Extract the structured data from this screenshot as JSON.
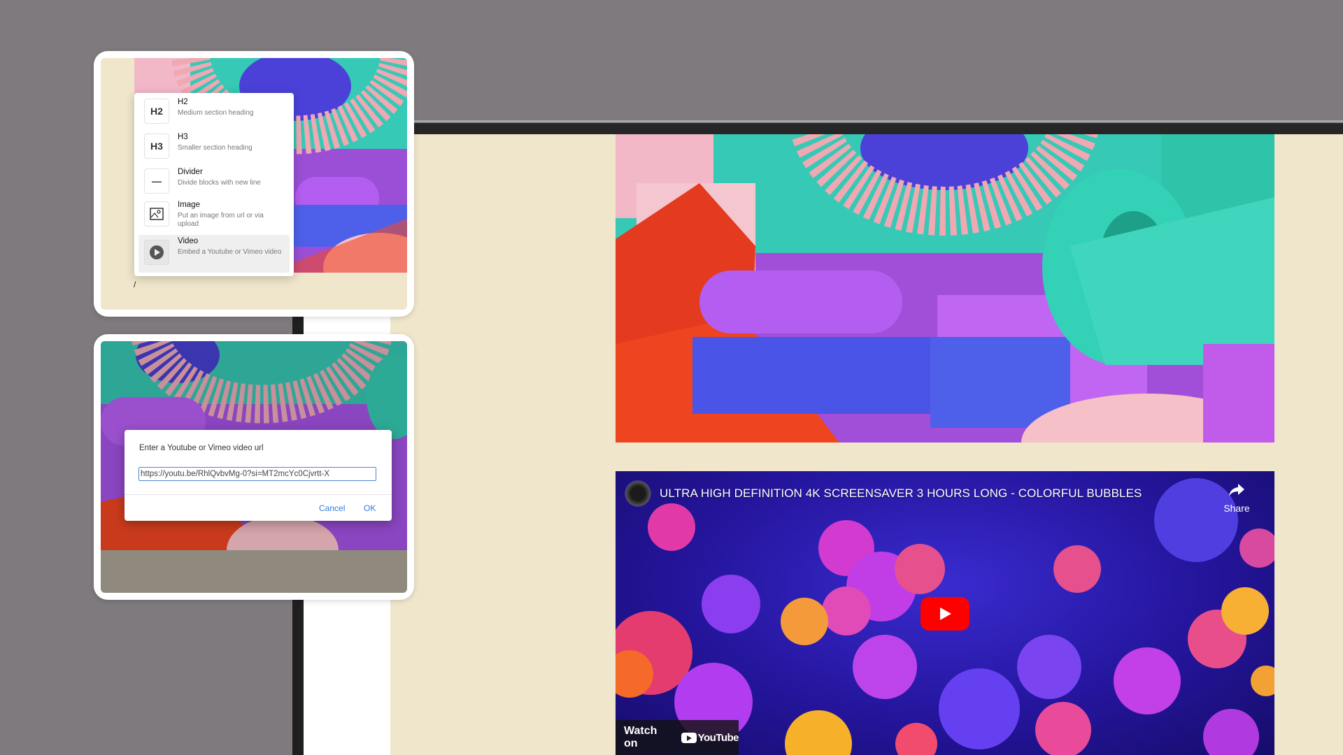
{
  "slash_menu": {
    "items": [
      {
        "icon": "H2",
        "icon_name": "heading-2-icon",
        "title": "H2",
        "desc": "Medium section heading"
      },
      {
        "icon": "H3",
        "icon_name": "heading-3-icon",
        "title": "H3",
        "desc": "Smaller section heading"
      },
      {
        "icon": "—",
        "icon_name": "divider-icon",
        "title": "Divider",
        "desc": "Divide blocks with new line"
      },
      {
        "icon": "",
        "icon_name": "image-icon",
        "title": "Image",
        "desc": "Put an image from url or via upload"
      },
      {
        "icon": "",
        "icon_name": "video-play-icon",
        "title": "Video",
        "desc": "Embed a Youtube or Vimeo video",
        "active": true
      }
    ],
    "slash_text": "/"
  },
  "video_dialog": {
    "label": "Enter a Youtube or Vimeo video url",
    "input_value": "https://youtu.be/RhlQvbvMg-0?si=MT2mcYc0Cjvrtt-X",
    "cancel_label": "Cancel",
    "ok_label": "OK"
  },
  "youtube_embed": {
    "title": "ULTRA HIGH DEFINITION 4K SCREENSAVER 3 HOURS LONG - COLORFUL BUBBLES",
    "share_label": "Share",
    "watch_on_label": "Watch on",
    "logo_text": "YouTube",
    "accent_color": "#ff0000"
  },
  "colors": {
    "canvas_bg": "#efe6cb",
    "outer_bg": "#7e7a7e",
    "link_blue": "#2c7be0"
  }
}
